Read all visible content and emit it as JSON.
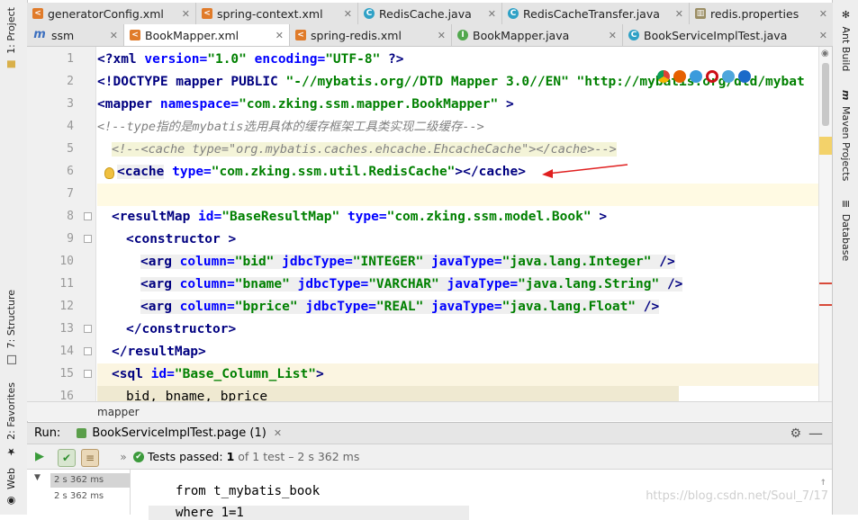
{
  "left_strip": {
    "project_tab": "1: Project",
    "structure_tab": "7: Structure",
    "favorites_tab": "2: Favorites",
    "web_tab": "Web"
  },
  "right_strip": {
    "ant_build": "Ant Build",
    "maven_projects": "Maven Projects",
    "database": "Database"
  },
  "tabs_row1": [
    {
      "label": "generatorConfig.xml",
      "icon": "xml"
    },
    {
      "label": "spring-context.xml",
      "icon": "xml"
    },
    {
      "label": "RedisCache.java",
      "icon": "class"
    },
    {
      "label": "RedisCacheTransfer.java",
      "icon": "class"
    },
    {
      "label": "redis.properties",
      "icon": "properties"
    }
  ],
  "tabs_row2": [
    {
      "label": "ssm",
      "icon": "maven"
    },
    {
      "label": "BookMapper.xml",
      "icon": "xml",
      "active": true
    },
    {
      "label": "spring-redis.xml",
      "icon": "xml"
    },
    {
      "label": "BookMapper.java",
      "icon": "interface"
    },
    {
      "label": "BookServiceImplTest.java",
      "icon": "class"
    }
  ],
  "editor": {
    "line_numbers": [
      "1",
      "2",
      "3",
      "4",
      "5",
      "6",
      "7",
      "8",
      "9",
      "10",
      "11",
      "12",
      "13",
      "14",
      "15",
      "16"
    ],
    "code": {
      "l1_tag": "<?xml",
      "l1_attr1": "version=",
      "l1_val1": "\"1.0\"",
      "l1_attr2": "encoding=",
      "l1_val2": "\"UTF-8\"",
      "l1_end": "?>",
      "l2_a": "<!DOCTYPE mapper PUBLIC",
      "l2_b": "\"-//mybatis.org//DTD Mapper 3.0//EN\"",
      "l2_c": "\"http://mybatis.org/dtd/mybat",
      "l3_tag": "<mapper",
      "l3_attr": "namespace=",
      "l3_val": "\"com.zking.ssm.mapper.BookMapper\"",
      "l3_end": ">",
      "l4_comment": "<!--type指的是mybatis选用具体的缓存框架工具类实现二级缓存-->",
      "l5_comment": "<!--<cache type=\"org.mybatis.caches.ehcache.EhcacheCache\"></cache>-->",
      "l6_tag": "<cache",
      "l6_attr": "type=",
      "l6_val": "\"com.zking.ssm.util.RedisCache\"",
      "l6_end": "></cache>",
      "l8_tag": "<resultMap",
      "l8_attr1": "id=",
      "l8_val1": "\"BaseResultMap\"",
      "l8_attr2": "type=",
      "l8_val2": "\"com.zking.ssm.model.Book\"",
      "l8_end": ">",
      "l9": "<constructor >",
      "l10_tag": "<arg",
      "l10_a1": "column=",
      "l10_v1": "\"bid\"",
      "l10_a2": "jdbcType=",
      "l10_v2": "\"INTEGER\"",
      "l10_a3": "javaType=",
      "l10_v3": "\"java.lang.Integer\"",
      "l10_end": "/>",
      "l11_tag": "<arg",
      "l11_a1": "column=",
      "l11_v1": "\"bname\"",
      "l11_a2": "jdbcType=",
      "l11_v2": "\"VARCHAR\"",
      "l11_a3": "javaType=",
      "l11_v3": "\"java.lang.String\"",
      "l11_end": "/>",
      "l12_tag": "<arg",
      "l12_a1": "column=",
      "l12_v1": "\"bprice\"",
      "l12_a2": "jdbcType=",
      "l12_v2": "\"REAL\"",
      "l12_a3": "javaType=",
      "l12_v3": "\"java.lang.Float\"",
      "l12_end": "/>",
      "l13": "</constructor>",
      "l14": "</resultMap>",
      "l15_tag": "<sql",
      "l15_attr": "id=",
      "l15_val": "\"Base_Column_List\"",
      "l15_end": ">",
      "l16": "bid, bname, bprice"
    },
    "breadcrumb": "mapper"
  },
  "run_panel": {
    "label": "Run:",
    "config": "BookServiceImplTest.page (1)",
    "status_prefix": "Tests passed:",
    "status_count": "1",
    "status_suffix": "of 1 test – 2 s 362 ms",
    "tree_time_1": "2 s 362 ms",
    "tree_time_2": "2 s 362 ms",
    "console_line1": "from t_mybatis_book",
    "console_line2": "where 1=1",
    "watermark": "https://blog.csdn.net/Soul_7/17"
  },
  "colors": {
    "arrow": "#e02020",
    "tag": "#000080",
    "attribute": "#0000ff",
    "value": "#008000",
    "comment": "#808080"
  }
}
